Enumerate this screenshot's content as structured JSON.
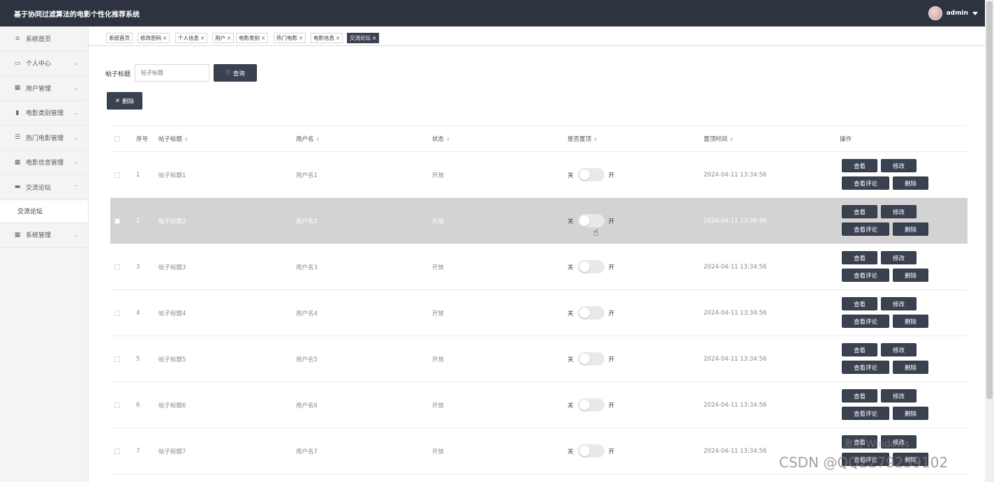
{
  "app": {
    "title": "基于协同过滤算法的电影个性化推荐系统",
    "user": "admin"
  },
  "sidebar": {
    "items": [
      {
        "label": "系统首页",
        "icon": "home-icon",
        "glyph": "⌂",
        "chev": ""
      },
      {
        "label": "个人中心",
        "icon": "user-icon",
        "glyph": "▭",
        "chev": "⌄"
      },
      {
        "label": "用户管理",
        "icon": "grid-icon",
        "glyph": "▦",
        "chev": "⌄"
      },
      {
        "label": "电影类别管理",
        "icon": "clipboard-icon",
        "glyph": "▮",
        "chev": "⌄"
      },
      {
        "label": "热门电影管理",
        "icon": "sliders-icon",
        "glyph": "☰",
        "chev": "⌄"
      },
      {
        "label": "电影信息管理",
        "icon": "grid-icon",
        "glyph": "▦",
        "chev": "⌄"
      },
      {
        "label": "交流论坛",
        "icon": "briefcase-icon",
        "glyph": "▬",
        "chev": "⌃"
      }
    ],
    "sub_active": "交流论坛",
    "last": {
      "label": "系统管理",
      "icon": "grid-icon",
      "glyph": "▦",
      "chev": "⌄"
    }
  },
  "tabs": [
    {
      "label": "系统首页",
      "closable": false
    },
    {
      "label": "修改密码",
      "closable": true
    },
    {
      "label": "个人信息",
      "closable": true
    },
    {
      "label": "用户",
      "closable": true
    },
    {
      "label": "电影类别",
      "closable": true
    },
    {
      "label": "热门电影",
      "closable": true
    },
    {
      "label": "电影信息",
      "closable": true
    },
    {
      "label": "交流论坛",
      "closable": true,
      "active": true
    }
  ],
  "search": {
    "label": "帖子标题",
    "placeholder": "帖子标题",
    "button": "查询",
    "delete": "删除"
  },
  "table": {
    "headers": {
      "index": "序号",
      "title": "帖子标题",
      "username": "用户名",
      "status": "状态",
      "pinned": "是否置顶",
      "pin_time": "置顶时间",
      "actions": "操作"
    },
    "switch_off": "关",
    "switch_on": "开",
    "actions": {
      "view": "查看",
      "edit": "修改",
      "view_comments": "查看评论",
      "delete": "删除"
    },
    "rows": [
      {
        "index": "1",
        "title": "帖子标题1",
        "username": "用户名1",
        "status": "开放",
        "pin_time": "2024-04-11 13:34:56"
      },
      {
        "index": "2",
        "title": "帖子标题2",
        "username": "用户名2",
        "status": "开放",
        "pin_time": "2024-04-11 13:46:56"
      },
      {
        "index": "3",
        "title": "帖子标题3",
        "username": "用户名3",
        "status": "开放",
        "pin_time": "2024-04-11 13:34:56"
      },
      {
        "index": "4",
        "title": "帖子标题4",
        "username": "用户名4",
        "status": "开放",
        "pin_time": "2024-04-11 13:34:56"
      },
      {
        "index": "5",
        "title": "帖子标题5",
        "username": "用户名5",
        "status": "开放",
        "pin_time": "2024-04-11 13:34:56"
      },
      {
        "index": "6",
        "title": "帖子标题6",
        "username": "用户名6",
        "status": "开放",
        "pin_time": "2024-04-11 13:34:56"
      },
      {
        "index": "7",
        "title": "帖子标题7",
        "username": "用户名7",
        "status": "开放",
        "pin_time": "2024-04-11 13:34:56"
      }
    ]
  },
  "watermarks": {
    "windows": "激活 Windows",
    "csdn": "CSDN @QQ2279239102"
  }
}
